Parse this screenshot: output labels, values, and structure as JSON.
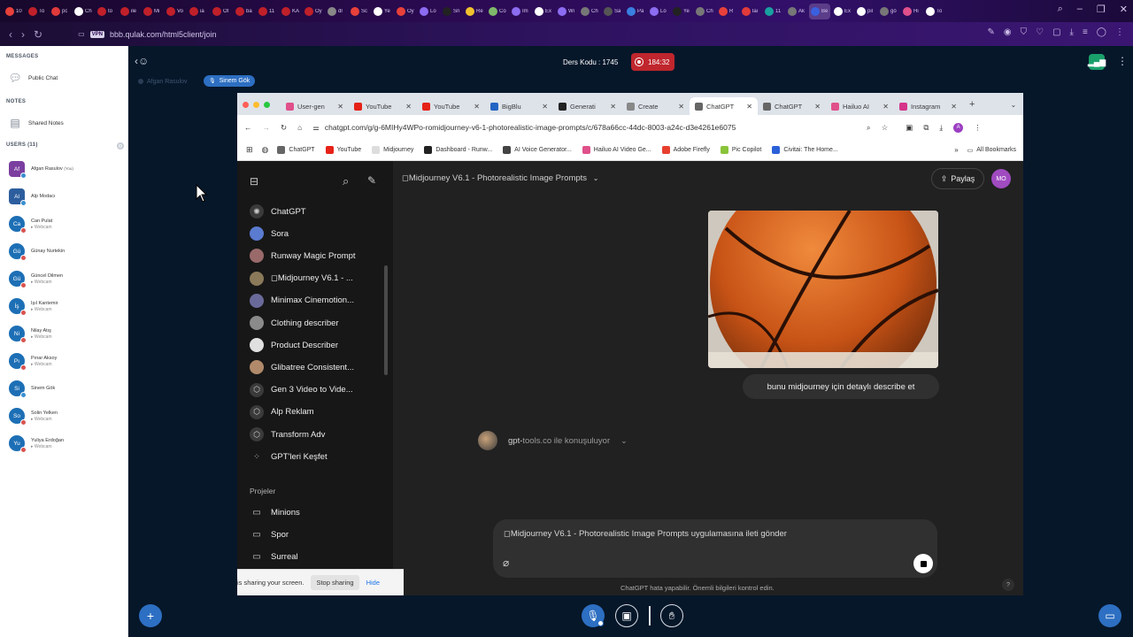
{
  "outer_browser": {
    "tabs": [
      "10",
      "To",
      "pc",
      "Ch",
      "to",
      "ile",
      "Mi",
      "Vo",
      "ia",
      "Ot",
      "ba",
      "11",
      "KA",
      "Oy",
      "dr",
      "Sc",
      "Ye",
      "Oy",
      "Lo",
      "Sn",
      "Re",
      "Co",
      "Im",
      "Ex",
      "Wi",
      "Ch",
      "Sa",
      "Pa",
      "Lo",
      "Ye",
      "Ch",
      "R",
      "lai",
      "11",
      "Ak",
      "Be",
      "Ex",
      "pil",
      "gö",
      "Hi",
      "To"
    ],
    "url": "bbb.qulak.com/html5client/join",
    "vpn_label": "VPN"
  },
  "bbb": {
    "course_label": "Ders Kodu : 1745",
    "record_time": "184:32",
    "talkers": [
      "Afgan Rasulov",
      "Sinem Gök"
    ],
    "messages_header": "MESSAGES",
    "public_chat": "Public Chat",
    "notes_header": "NOTES",
    "shared_notes": "Shared Notes",
    "users_header": "USERS (11)",
    "users": [
      {
        "initials": "Af",
        "name": "Afgan Rasulov",
        "you": "(You)",
        "status": "",
        "color": "#7b3fa0",
        "dot": "#3a8fd0"
      },
      {
        "initials": "Al",
        "name": "Alp Modacı",
        "you": "",
        "status": "",
        "color": "#2c5e9e",
        "dot": "#3a8fd0"
      },
      {
        "initials": "Ca",
        "name": "Can Pulat",
        "you": "",
        "status": "Webcam",
        "color": "#1d6fb5",
        "dot": "#d9534f"
      },
      {
        "initials": "Gü",
        "name": "Günay Nurtekin",
        "you": "",
        "status": "",
        "color": "#1d6fb5",
        "dot": "#d9534f"
      },
      {
        "initials": "Gü",
        "name": "Güncel Dilmen",
        "you": "",
        "status": "Webcam",
        "color": "#1d6fb5",
        "dot": "#d9534f"
      },
      {
        "initials": "İş",
        "name": "Işıl Kantemir",
        "you": "",
        "status": "Webcam",
        "color": "#1d6fb5",
        "dot": "#d9534f"
      },
      {
        "initials": "Ni",
        "name": "Nilay Atış",
        "you": "",
        "status": "Webcam",
        "color": "#1d6fb5",
        "dot": "#d9534f"
      },
      {
        "initials": "Pı",
        "name": "Pınar Aksoy",
        "you": "",
        "status": "Webcam",
        "color": "#1d6fb5",
        "dot": "#d9534f"
      },
      {
        "initials": "Si",
        "name": "Sinem Gök",
        "you": "",
        "status": "",
        "color": "#1d6fb5",
        "dot": "#3a8fd0"
      },
      {
        "initials": "So",
        "name": "Solin Yelken",
        "you": "",
        "status": "Webcam",
        "color": "#1d6fb5",
        "dot": "#d9534f"
      },
      {
        "initials": "Yu",
        "name": "Yuliya Erdoğan",
        "you": "",
        "status": "Webcam",
        "color": "#1d6fb5",
        "dot": "#d9534f"
      }
    ]
  },
  "inner_browser": {
    "tabs": [
      {
        "label": "User-gen",
        "color": "#e0508a"
      },
      {
        "label": "YouTube",
        "color": "#e62117"
      },
      {
        "label": "YouTube",
        "color": "#e62117"
      },
      {
        "label": "BigBlu",
        "color": "#2264c4"
      },
      {
        "label": "Generati",
        "color": "#222"
      },
      {
        "label": "Create",
        "color": "#888"
      },
      {
        "label": "ChatGPT",
        "color": "#666",
        "active": true
      },
      {
        "label": "ChatGPT",
        "color": "#666"
      },
      {
        "label": "Hailuo AI",
        "color": "#e0508a"
      },
      {
        "label": "Instagram",
        "color": "#d6348a"
      }
    ],
    "url": "chatgpt.com/g/g-6MIHy4WPo-romidjourney-v6-1-photorealistic-image-prompts/c/678a66cc-44dc-8003-a24c-d3e4261e6075",
    "bookmarks": [
      {
        "label": "ChatGPT",
        "color": "#666"
      },
      {
        "label": "YouTube",
        "color": "#e62117"
      },
      {
        "label": "Midjourney",
        "color": "#ddd"
      },
      {
        "label": "Dashboard - Runw...",
        "color": "#222"
      },
      {
        "label": "AI Voice Generator...",
        "color": "#444"
      },
      {
        "label": "Hailuo AI Video Ge...",
        "color": "#e0508a"
      },
      {
        "label": "Adobe Firefly",
        "color": "#e8402f"
      },
      {
        "label": "Pic Copilot",
        "color": "#8ac43a"
      },
      {
        "label": "Civitai: The Home...",
        "color": "#2a60d8"
      }
    ],
    "all_bookmarks": "All Bookmarks"
  },
  "chatgpt": {
    "sidebar": [
      "ChatGPT",
      "Sora",
      "Runway Magic Prompt",
      "◻Midjourney V6.1 - ...",
      "Minimax Cinemotion...",
      "Clothing describer",
      "Product Describer",
      "Glibatree Consistent...",
      "Gen 3 Video to Vide...",
      "Alp Reklam",
      "Transform Adv",
      "GPT'leri Keşfet"
    ],
    "projects_header": "Projeler",
    "projects": [
      "Minions",
      "Spor",
      "Surreal"
    ],
    "title": "◻Midjourney V6.1 - Photorealistic Image Prompts",
    "share_label": "Paylaş",
    "avatar": "MO",
    "user_message": "bunu midjourney için detaylı describe et",
    "gpt_status_pre": "gpt-",
    "gpt_status": "tools.co ile konuşuluyor",
    "composer_placeholder": "◻Midjourney V6.1 - Photorealistic Image Prompts uygulamasına ileti gönder",
    "disclaimer": "ChatGPT hata yapabilir. Önemli bilgileri kontrol edin."
  },
  "share_bar": {
    "text": "is sharing your screen.",
    "stop": "Stop sharing",
    "hide": "Hide"
  }
}
